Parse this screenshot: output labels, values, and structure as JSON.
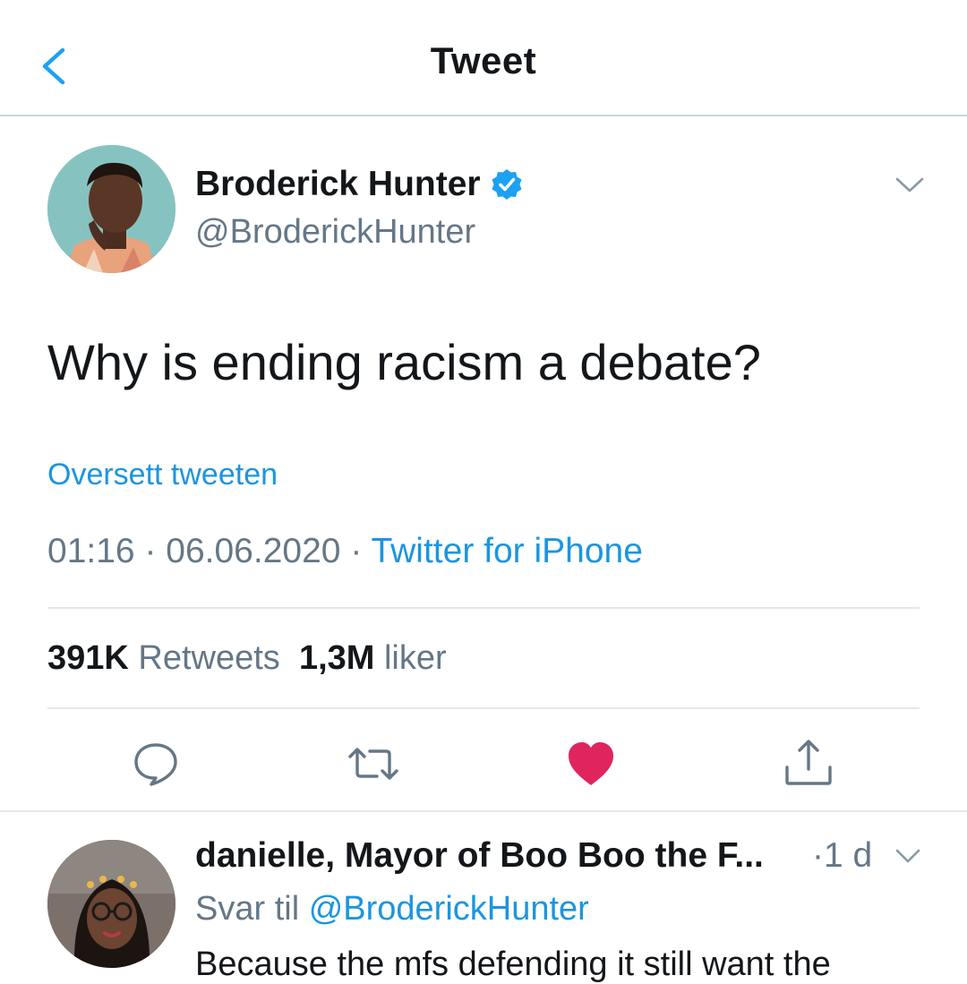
{
  "header": {
    "title": "Tweet",
    "back_icon": "chevron-left-icon"
  },
  "tweet": {
    "author_name": "Broderick Hunter",
    "verified_icon": "verified-badge-icon",
    "author_handle": "@BroderickHunter",
    "text": "Why is ending racism a debate?",
    "translate_label": "Oversett tweeten",
    "time": "01:16",
    "separator": " · ",
    "date": "06.06.2020",
    "source": "Twitter for iPhone",
    "stats": {
      "retweets_count": "391K",
      "retweets_label": "Retweets",
      "likes_count": "1,3M",
      "likes_label": "liker"
    },
    "actions": [
      "reply-icon",
      "retweet-icon",
      "like-icon",
      "share-icon"
    ],
    "liked": true
  },
  "reply": {
    "author_name": "danielle, Mayor of Boo Boo the F...",
    "time": "·1 d",
    "reply_to_label": "Svar til",
    "reply_to_handle": "@BroderickHunter",
    "text": "Because the mfs defending it still want the"
  },
  "colors": {
    "accent": "#1da1f2",
    "link": "#1b95e0",
    "secondary_text": "#657786",
    "like": "#e0245e",
    "divider": "#e1e8ed"
  }
}
